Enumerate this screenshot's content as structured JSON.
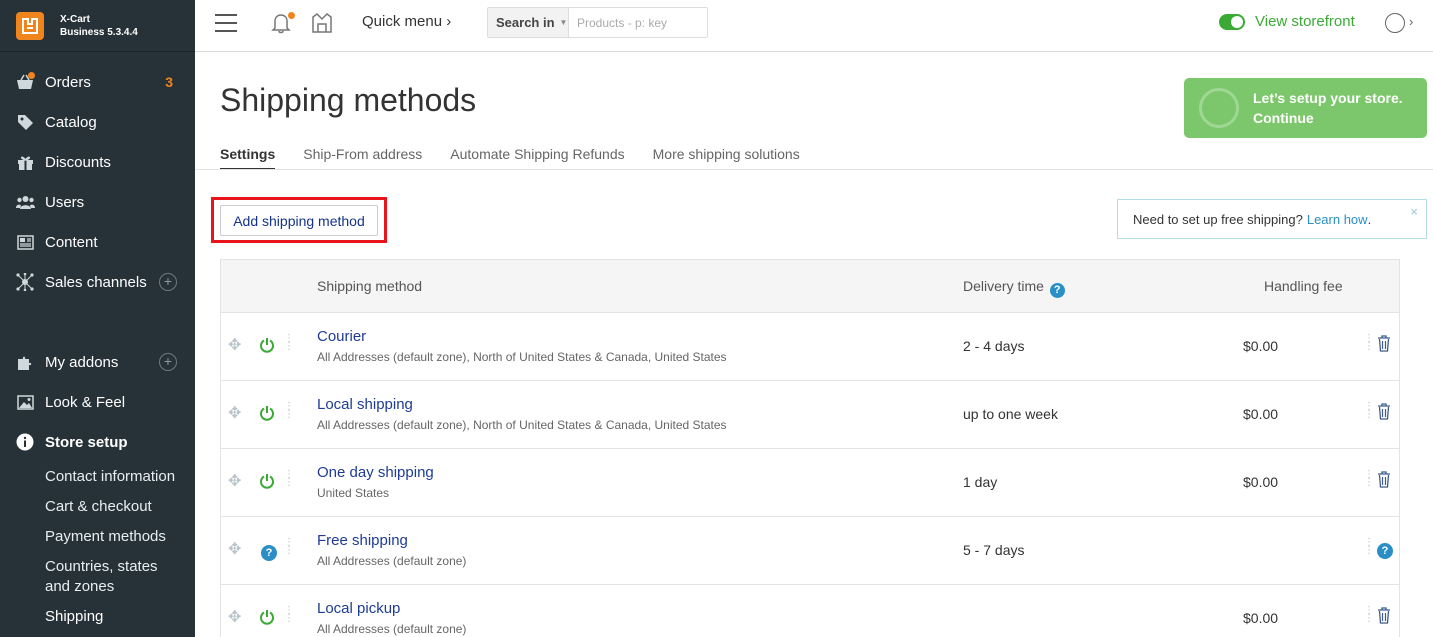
{
  "brand": {
    "name": "X-Cart",
    "version": "Business 5.3.4.4"
  },
  "sidebar": {
    "items": [
      {
        "label": "Orders",
        "badge": "3"
      },
      {
        "label": "Catalog"
      },
      {
        "label": "Discounts"
      },
      {
        "label": "Users"
      },
      {
        "label": "Content"
      },
      {
        "label": "Sales channels"
      },
      {
        "label": "My addons"
      },
      {
        "label": "Look & Feel"
      },
      {
        "label": "Store setup"
      }
    ],
    "subitems": [
      "Contact information",
      "Cart & checkout",
      "Payment methods",
      "Countries, states and zones",
      "Shipping"
    ]
  },
  "topbar": {
    "quick_menu": "Quick menu",
    "search_in": "Search in",
    "search_placeholder": "Products - p: key",
    "view_storefront": "View storefront"
  },
  "page": {
    "title": "Shipping methods",
    "tabs": [
      "Settings",
      "Ship-From address",
      "Automate Shipping Refunds",
      "More shipping solutions"
    ],
    "setup_line1": "Let’s setup your store.",
    "setup_line2": "Continue",
    "add_button": "Add shipping method",
    "notice_text": "Need to set up free shipping?",
    "notice_link": "Learn how",
    "notice_close": "×"
  },
  "table": {
    "headers": {
      "method": "Shipping method",
      "delivery": "Delivery time",
      "fee": "Handling fee"
    },
    "rows": [
      {
        "name": "Courier",
        "zone": "All Addresses (default zone), North of United States & Canada, United States",
        "time": "2 - 4 days",
        "fee": "$0.00",
        "status": "on"
      },
      {
        "name": "Local shipping",
        "zone": "All Addresses (default zone), North of United States & Canada, United States",
        "time": "up to one week",
        "fee": "$0.00",
        "status": "on"
      },
      {
        "name": "One day shipping",
        "zone": "United States",
        "time": "1 day",
        "fee": "$0.00",
        "status": "on"
      },
      {
        "name": "Free shipping",
        "zone": "All Addresses (default zone)",
        "time": "5 - 7 days",
        "fee": "",
        "status": "help"
      },
      {
        "name": "Local pickup",
        "zone": "All Addresses (default zone)",
        "time": "",
        "fee": "$0.00",
        "status": "on"
      }
    ]
  },
  "colors": {
    "sidebar_bg": "#263238",
    "accent_orange": "#f0851e",
    "green": "#3aaa35",
    "link_blue": "#1e3c96",
    "highlight_red": "#e8161a"
  }
}
